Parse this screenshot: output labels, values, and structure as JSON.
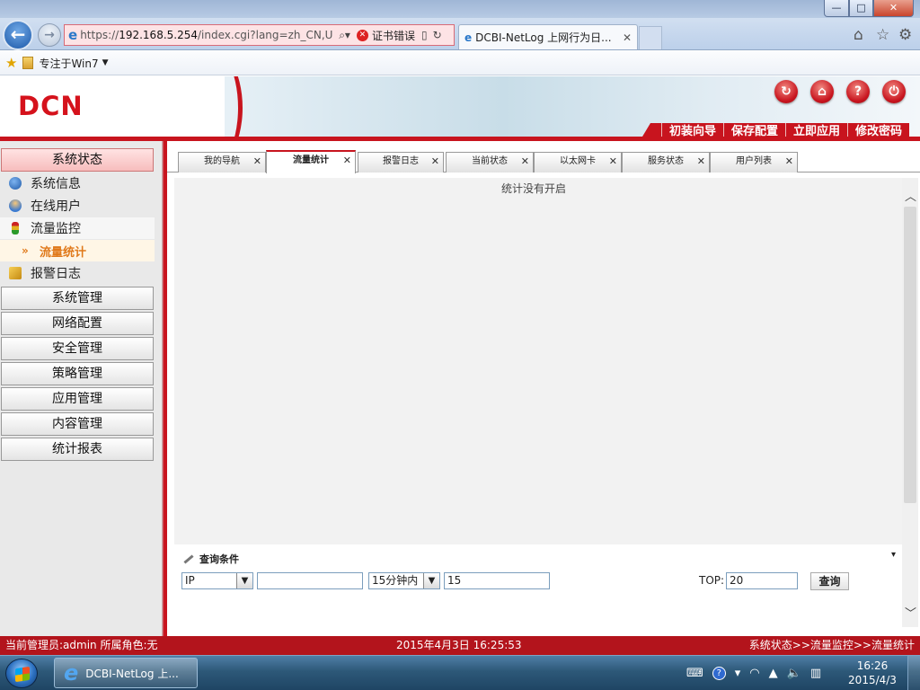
{
  "browser": {
    "address_url": "https://192.168.5.254/index.cgi?lang=zh_CN,U",
    "address_scheme": "https://",
    "address_host": "192.168.5.254",
    "address_path": "/index.cgi?lang=zh_CN,U",
    "cert_error": "证书错误",
    "tab_title": "DCBI-NetLog 上网行为日...",
    "favorites_item": "专注于Win7",
    "window_controls": {
      "minimize": "—",
      "maximize": "□",
      "close": "✕"
    }
  },
  "header": {
    "logo": "DCN",
    "actions": [
      "初装向导",
      "保存配置",
      "立即应用",
      "修改密码"
    ],
    "round_icons": [
      "refresh-icon",
      "home-icon",
      "help-icon",
      "logout-icon"
    ]
  },
  "sidebar": {
    "status_section": "系统状态",
    "status_items": [
      "系统信息",
      "在线用户",
      "流量监控",
      "报警日志"
    ],
    "sub_item": "流量统计",
    "sections": [
      "系统管理",
      "网络配置",
      "安全管理",
      "策略管理",
      "应用管理",
      "内容管理",
      "统计报表"
    ]
  },
  "tabs": [
    {
      "label": "我的导航",
      "active": false
    },
    {
      "label": "流量统计",
      "active": true
    },
    {
      "label": "报警日志",
      "active": false
    },
    {
      "label": "当前状态",
      "active": false
    },
    {
      "label": "以太网卡",
      "active": false
    },
    {
      "label": "服务状态",
      "active": false
    },
    {
      "label": "用户列表",
      "active": false
    }
  ],
  "content": {
    "empty_message": "统计没有开启"
  },
  "query": {
    "title": "查询条件",
    "type_value": "IP",
    "ip_value": "",
    "time_value": "15分钟内",
    "minutes_value": "15",
    "top_label": "TOP:",
    "top_value": "20",
    "search_label": "查询"
  },
  "statusbar": {
    "admin": "当前管理员:admin  所属角色:无",
    "datetime": "2015年4月3日  16:25:53",
    "path": "系统状态>>流量监控>>流量统计"
  },
  "taskbar": {
    "task_label": "DCBI-NetLog 上...",
    "clock_time": "16:26",
    "clock_date": "2015/4/3"
  },
  "colors": {
    "brand_red": "#c8141e",
    "sidebar_active": "#e0791a"
  }
}
